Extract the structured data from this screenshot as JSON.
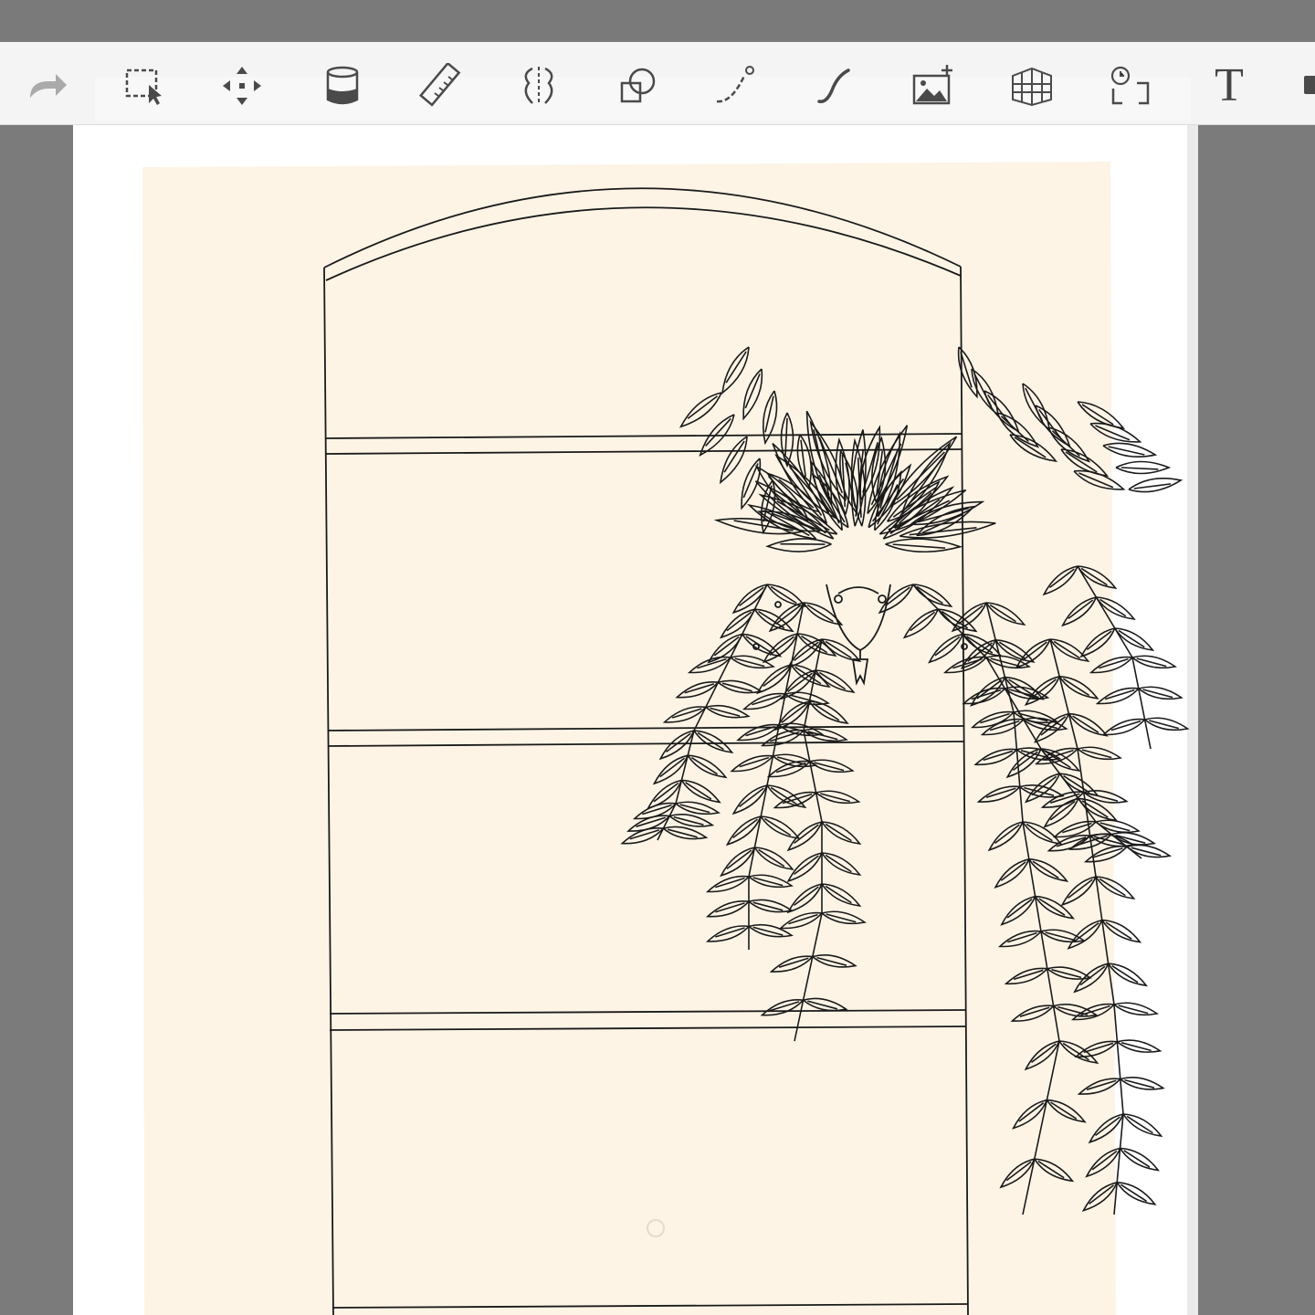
{
  "toolbar": {
    "tools": [
      {
        "name": "redo-icon"
      },
      {
        "name": "select-icon"
      },
      {
        "name": "move-icon"
      },
      {
        "name": "fill-icon"
      },
      {
        "name": "ruler-icon"
      },
      {
        "name": "symmetry-icon"
      },
      {
        "name": "shapes-icon"
      },
      {
        "name": "curve-icon"
      },
      {
        "name": "stroke-icon"
      },
      {
        "name": "add-image-icon"
      },
      {
        "name": "perspective-icon"
      },
      {
        "name": "time-lapse-icon"
      },
      {
        "name": "text-icon"
      }
    ],
    "text_tool_label": "T"
  },
  "colors": {
    "workspace": "#7b7b7b",
    "toolbar_bg": "#f4f4f4",
    "paper": "#ffffff",
    "canvas_fill": "#fdf4e6",
    "line_art": "#1a1a1a",
    "icon": "#4a4a4a",
    "icon_disabled": "#aaaaaa"
  }
}
